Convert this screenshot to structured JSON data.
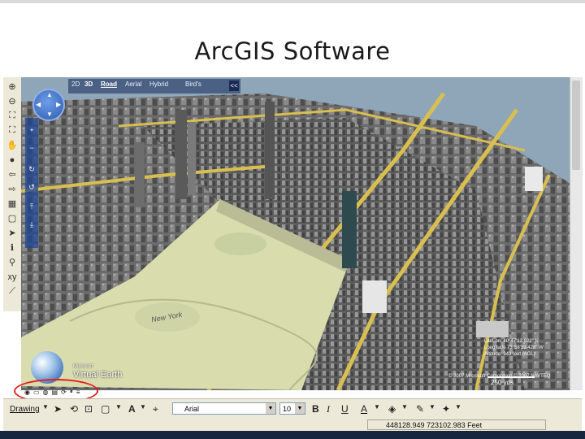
{
  "slide": {
    "title": "ArcGIS Software"
  },
  "map_nav": {
    "modes": [
      "2D",
      "3D",
      "Road",
      "Aerial",
      "Hybrid",
      "Bird's"
    ],
    "active_mode": "Road",
    "collapse_label": "<<"
  },
  "map": {
    "park_label": "New York",
    "logo_small": "Microsoft",
    "logo_text": "Virtual Earth",
    "scale_label": "250 yds",
    "coordinates_overlay": [
      "Lat/Lon: 40°47'12.922\" N",
      "Longitude 73°58'39.428\" W",
      "Altitude: 343 feet (AGL)"
    ],
    "copyright": "© 2007 Microsoft Corporation   © 2007 NAVTEQ"
  },
  "drawing_toolbar": {
    "drawing_label": "Drawing",
    "font_name": "Arial",
    "font_size": "10",
    "bold": "B",
    "italic": "I",
    "underline": "U",
    "font_color": "A"
  },
  "status": {
    "coordinates": "448128.949  723102.983 Feet"
  },
  "colors": {
    "highlight_oval": "#e02020",
    "map_overlay": "#2c5bb0",
    "toolbar_bg": "#ece9d8"
  }
}
